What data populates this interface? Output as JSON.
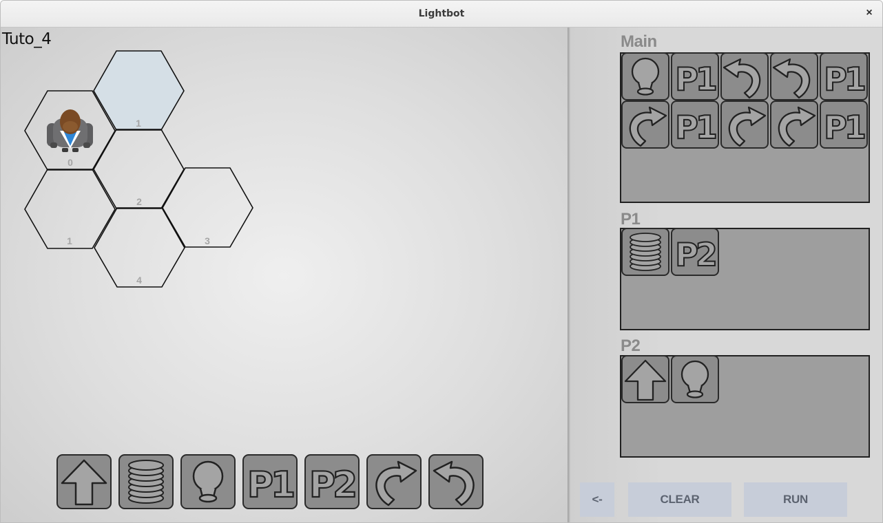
{
  "window": {
    "title": "Lightbot",
    "close_glyph": "×"
  },
  "level": {
    "name": "Tuto_4"
  },
  "board": {
    "cells": [
      {
        "height": "1",
        "lit": true
      },
      {
        "height": "0",
        "lit": false,
        "robot": true
      },
      {
        "height": "2",
        "lit": false
      },
      {
        "height": "1",
        "lit": false
      },
      {
        "height": "3",
        "lit": false
      },
      {
        "height": "4",
        "lit": false
      }
    ],
    "highlight_color": "#d5dfe6"
  },
  "procedures": {
    "main": {
      "label": "Main",
      "commands": [
        "light",
        "p1",
        "turn-left",
        "turn-left",
        "p1",
        "turn-right",
        "p1",
        "turn-right",
        "turn-right",
        "p1"
      ]
    },
    "p1": {
      "label": "P1",
      "commands": [
        "jump",
        "p2"
      ]
    },
    "p2": {
      "label": "P2",
      "commands": [
        "forward",
        "light"
      ]
    }
  },
  "toolbar": {
    "commands": [
      "forward",
      "jump",
      "light",
      "p1",
      "p2",
      "turn-right",
      "turn-left"
    ]
  },
  "controls": {
    "back_label": "<-",
    "clear_label": "CLEAR",
    "run_label": "RUN"
  },
  "icons": {
    "p1_text": "P1",
    "p2_text": "P2"
  }
}
